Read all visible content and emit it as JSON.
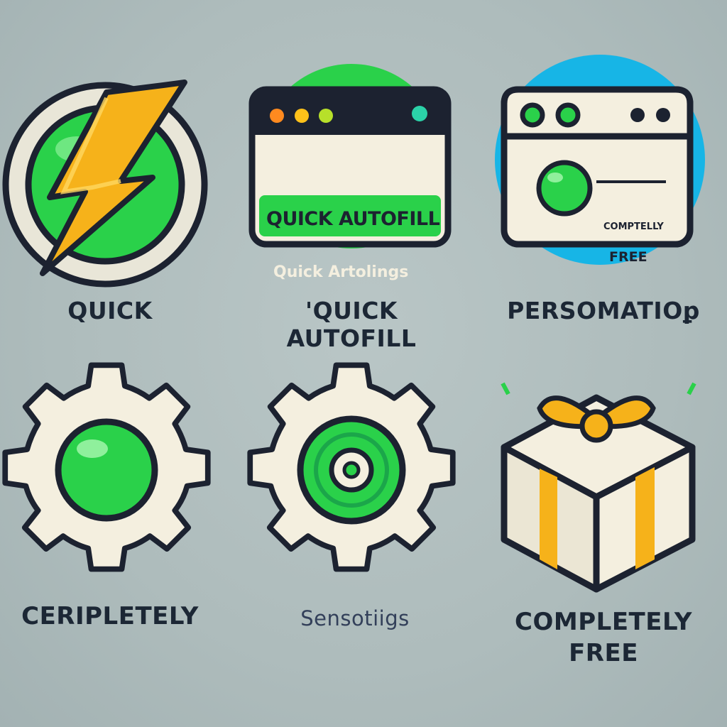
{
  "colors": {
    "outline": "#1c2230",
    "green": "#2ad14a",
    "blue": "#17b5e6",
    "cream": "#f4efdf",
    "yellow": "#f6b21a"
  },
  "tiles": [
    {
      "icon": "lightning-bolt-icon",
      "caption": "QUICK"
    },
    {
      "icon": "browser-window-icon",
      "caption": "'QUICK AUTOFILL",
      "window_title": "QUICK AUTOFILL",
      "window_bar_text": "Quick Artolings"
    },
    {
      "icon": "browser-window-icon",
      "caption": "PERSOMATIOꝑ",
      "window_line1": "COMPTELLY",
      "window_line2": "FREE"
    },
    {
      "icon": "gear-icon",
      "caption": "CERIPLETELY"
    },
    {
      "icon": "gear-icon",
      "caption": "Sensotiigs"
    },
    {
      "icon": "gift-box-icon",
      "caption_line1": "COMPLETELY",
      "caption_line2": "FREE"
    }
  ]
}
